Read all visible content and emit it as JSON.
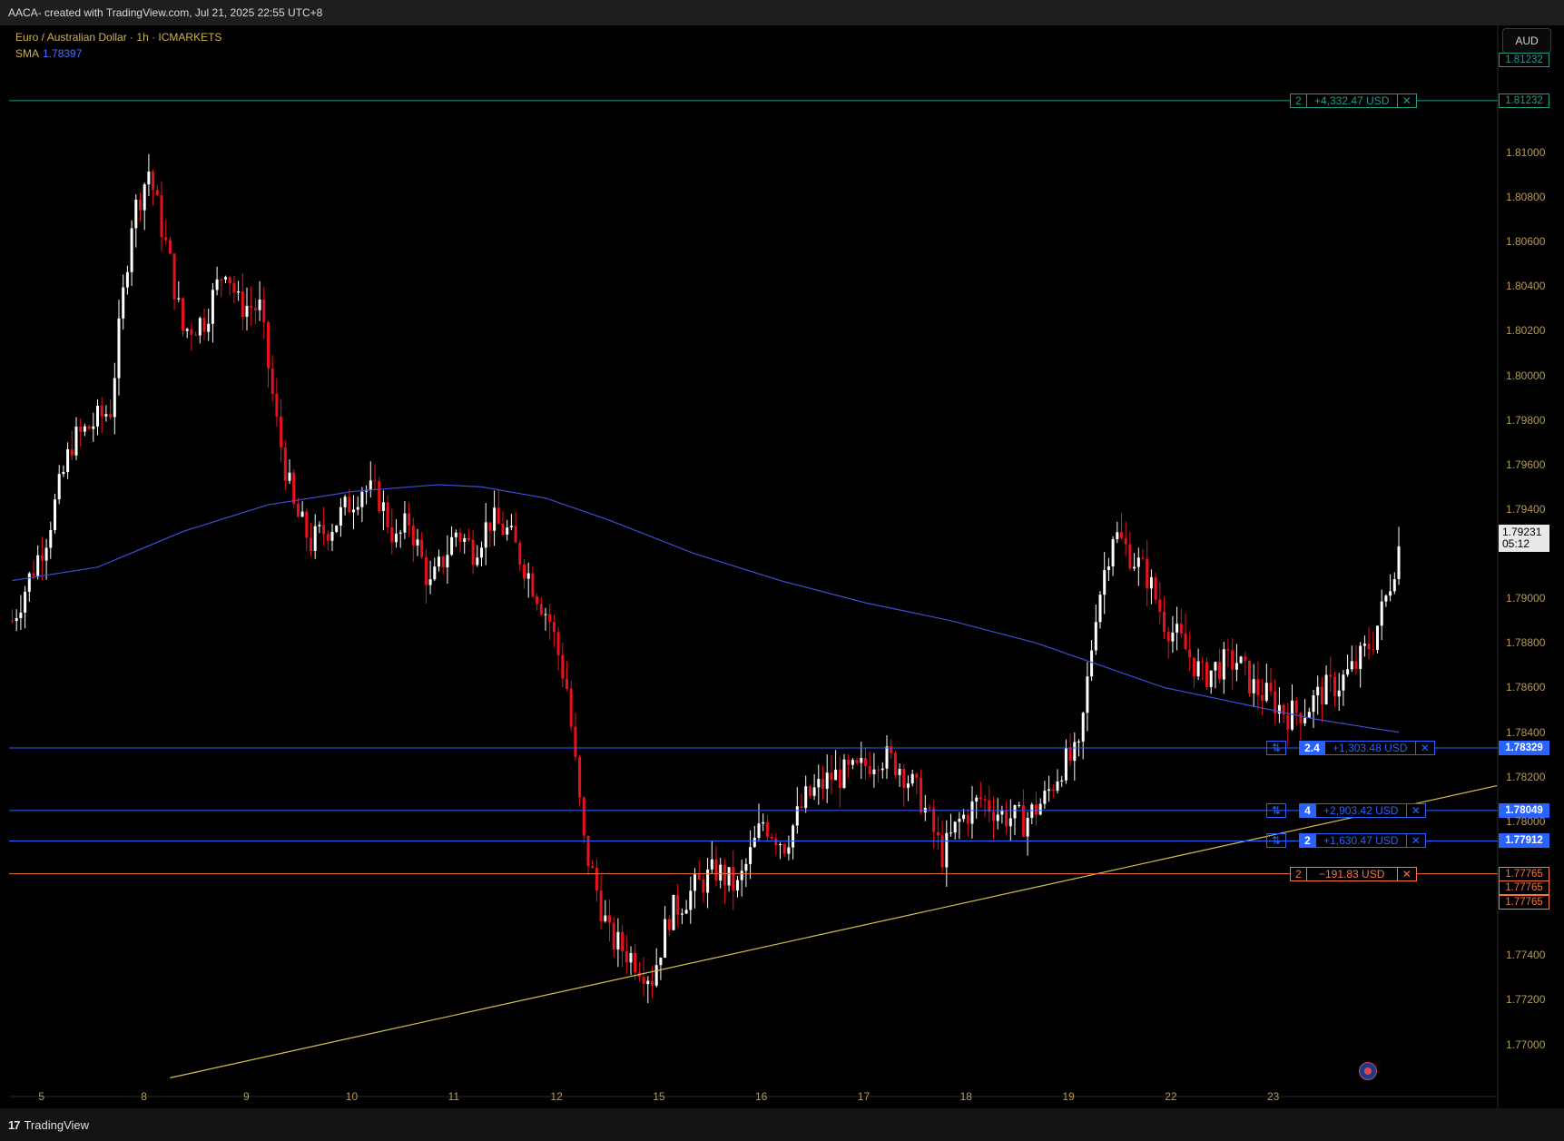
{
  "header": {
    "title": "AACA- created with TradingView.com, Jul 21, 2025 22:55 UTC+8"
  },
  "legend": {
    "symbol": "Euro / Australian Dollar · 1h · ICMARKETS",
    "sma_label": "SMA",
    "sma_value": "1.78397"
  },
  "currency_button": "AUD",
  "branding": "TradingView",
  "current_price": {
    "price": "1.79231",
    "countdown": "05:12"
  },
  "colors": {
    "background": "#000000",
    "up_candle": "#ffffff",
    "down_candle": "#e8121a",
    "sma": "#3c4fd6",
    "trendline": "#d7c24a",
    "tp_line": "#1f9c88",
    "entry_line": "#2962ff",
    "sl_line": "#f7743f"
  },
  "orders": [
    {
      "id": "tp",
      "price": 1.81232,
      "price_label": "1.81232",
      "qty": "2",
      "pnl": "+4,332.47 USD",
      "type": "take-profit",
      "color": "#1f9c88"
    },
    {
      "id": "entry1",
      "price": 1.78329,
      "price_label": "1.78329",
      "qty": "2.4",
      "pnl": "+1,303.48 USD",
      "type": "position",
      "color": "#2962ff"
    },
    {
      "id": "entry2",
      "price": 1.78049,
      "price_label": "1.78049",
      "qty": "4",
      "pnl": "+2,903.42 USD",
      "type": "position",
      "color": "#2962ff"
    },
    {
      "id": "entry3",
      "price": 1.77912,
      "price_label": "1.77912",
      "qty": "2",
      "pnl": "+1,630.47 USD",
      "type": "position",
      "color": "#2962ff"
    },
    {
      "id": "sl",
      "price": 1.77765,
      "price_label": "1.77765",
      "qty": "2",
      "pnl": "−191.83 USD",
      "type": "stop-loss",
      "color": "#f7743f"
    }
  ],
  "extra_price_tags": [
    {
      "price_label": "1.81232",
      "color": "#1f9c88"
    },
    {
      "price_label": "1.77765",
      "color": "#f7743f"
    },
    {
      "price_label": "1.77765",
      "color": "#f7743f"
    }
  ],
  "chart_data": {
    "type": "candlestick",
    "title": "",
    "xlabel": "",
    "ylabel": "",
    "ylim": [
      1.7688,
      1.8148
    ],
    "y_ticks": [
      "1.81000",
      "1.80800",
      "1.80600",
      "1.80400",
      "1.80200",
      "1.80000",
      "1.79800",
      "1.79600",
      "1.79400",
      "1.79000",
      "1.78800",
      "1.78600",
      "1.78400",
      "1.78200",
      "1.78000",
      "1.77400",
      "1.77200",
      "1.77000"
    ],
    "x_ticks": [
      "5",
      "8",
      "9",
      "10",
      "11",
      "12",
      "15",
      "16",
      "17",
      "18",
      "19",
      "22",
      "23"
    ],
    "x_tick_index": [
      7,
      31,
      55,
      79,
      103,
      127,
      151,
      175,
      199,
      223,
      247,
      271,
      295
    ],
    "candle_count": 279,
    "anchors": [
      [
        0,
        1.789
      ],
      [
        8,
        1.7928
      ],
      [
        14,
        1.797
      ],
      [
        23,
        1.7985
      ],
      [
        28,
        1.807
      ],
      [
        32,
        1.8092
      ],
      [
        37,
        1.805
      ],
      [
        40,
        1.802
      ],
      [
        45,
        1.8025
      ],
      [
        50,
        1.805
      ],
      [
        53,
        1.8032
      ],
      [
        58,
        1.803
      ],
      [
        62,
        1.7978
      ],
      [
        66,
        1.794
      ],
      [
        70,
        1.7925
      ],
      [
        76,
        1.7935
      ],
      [
        82,
        1.795
      ],
      [
        86,
        1.7945
      ],
      [
        90,
        1.7925
      ],
      [
        93,
        1.7935
      ],
      [
        98,
        1.7905
      ],
      [
        104,
        1.793
      ],
      [
        108,
        1.7922
      ],
      [
        112,
        1.7935
      ],
      [
        116,
        1.793
      ],
      [
        120,
        1.7915
      ],
      [
        126,
        1.789
      ],
      [
        130,
        1.786
      ],
      [
        134,
        1.779
      ],
      [
        140,
        1.7748
      ],
      [
        146,
        1.7738
      ],
      [
        150,
        1.773
      ],
      [
        154,
        1.7758
      ],
      [
        160,
        1.777
      ],
      [
        165,
        1.7778
      ],
      [
        170,
        1.777
      ],
      [
        176,
        1.78
      ],
      [
        181,
        1.779
      ],
      [
        186,
        1.781
      ],
      [
        192,
        1.782
      ],
      [
        198,
        1.7822
      ],
      [
        203,
        1.783
      ],
      [
        208,
        1.7825
      ],
      [
        213,
        1.781
      ],
      [
        218,
        1.7785
      ],
      [
        222,
        1.78
      ],
      [
        227,
        1.781
      ],
      [
        232,
        1.7803
      ],
      [
        237,
        1.78
      ],
      [
        242,
        1.781
      ],
      [
        246,
        1.7825
      ],
      [
        250,
        1.783
      ],
      [
        254,
        1.7895
      ],
      [
        258,
        1.793
      ],
      [
        262,
        1.792
      ],
      [
        266,
        1.791
      ],
      [
        270,
        1.789
      ],
      [
        274,
        1.788
      ],
      [
        279,
        1.7865
      ],
      [
        283,
        1.787
      ],
      [
        287,
        1.7872
      ],
      [
        291,
        1.786
      ],
      [
        295,
        1.7855
      ],
      [
        299,
        1.7848
      ],
      [
        303,
        1.785
      ],
      [
        307,
        1.7858
      ],
      [
        311,
        1.7862
      ],
      [
        315,
        1.787
      ],
      [
        319,
        1.7882
      ],
      [
        322,
        1.79
      ],
      [
        325,
        1.7923
      ]
    ],
    "sma_points": [
      [
        0,
        1.7908
      ],
      [
        20,
        1.7914
      ],
      [
        40,
        1.793
      ],
      [
        60,
        1.7942
      ],
      [
        80,
        1.7948
      ],
      [
        100,
        1.7951
      ],
      [
        110,
        1.795
      ],
      [
        125,
        1.7945
      ],
      [
        140,
        1.7935
      ],
      [
        160,
        1.792
      ],
      [
        180,
        1.7908
      ],
      [
        200,
        1.7898
      ],
      [
        220,
        1.789
      ],
      [
        240,
        1.788
      ],
      [
        255,
        1.787
      ],
      [
        270,
        1.786
      ],
      [
        290,
        1.7852
      ],
      [
        305,
        1.7846
      ],
      [
        318,
        1.7842
      ],
      [
        325,
        1.784
      ]
    ],
    "trendline": {
      "x1": 37,
      "y1": 1.7685,
      "x2": 348,
      "y2": 1.7816
    }
  }
}
